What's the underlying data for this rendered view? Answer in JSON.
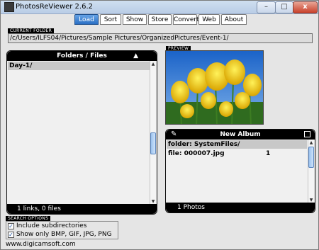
{
  "app": {
    "title": "PhotosReViewer 2.6.2"
  },
  "window_controls": {
    "minimize": "–",
    "maximize": "□",
    "close": "x"
  },
  "tabs": [
    {
      "label": "Load",
      "active": true
    },
    {
      "label": "Sort",
      "active": false
    },
    {
      "label": "Show",
      "active": false
    },
    {
      "label": "Store",
      "active": false
    },
    {
      "label": "Convert",
      "active": false
    },
    {
      "label": "Web",
      "active": false
    },
    {
      "label": "About",
      "active": false
    }
  ],
  "current_folder": {
    "label": "CURRENT FOLDER",
    "path": "/c/Users/ILFS04/Pictures/Sample Pictures/OrganizedPictures/Event-1/"
  },
  "folders_panel": {
    "title": "Folders / Files",
    "items": [
      "Day-1/"
    ],
    "status": "1 links, 0 files"
  },
  "preview": {
    "label": "PREVIEW",
    "icon": "tulip-photo"
  },
  "album_panel": {
    "title": "New Album",
    "rows": [
      {
        "name": "folder: SystemFiles/",
        "count": ""
      },
      {
        "name": "file: 000007.jpg",
        "count": "1"
      }
    ],
    "status": "1 Photos",
    "left_icon": "broom-icon",
    "right_icon": "save-icon"
  },
  "search_options": {
    "label": "SEARCH OPTIONS",
    "options": [
      {
        "label": "Include subdirectories",
        "checked": true
      },
      {
        "label": "Show only BMP, GIF, JPG, PNG",
        "checked": true
      }
    ]
  },
  "footer": {
    "website": "www.digicamsoft.com"
  },
  "colors": {
    "tab_active": "#2a6fc4",
    "panel_header": "#000000",
    "row_highlight": "#c8c8c8"
  }
}
